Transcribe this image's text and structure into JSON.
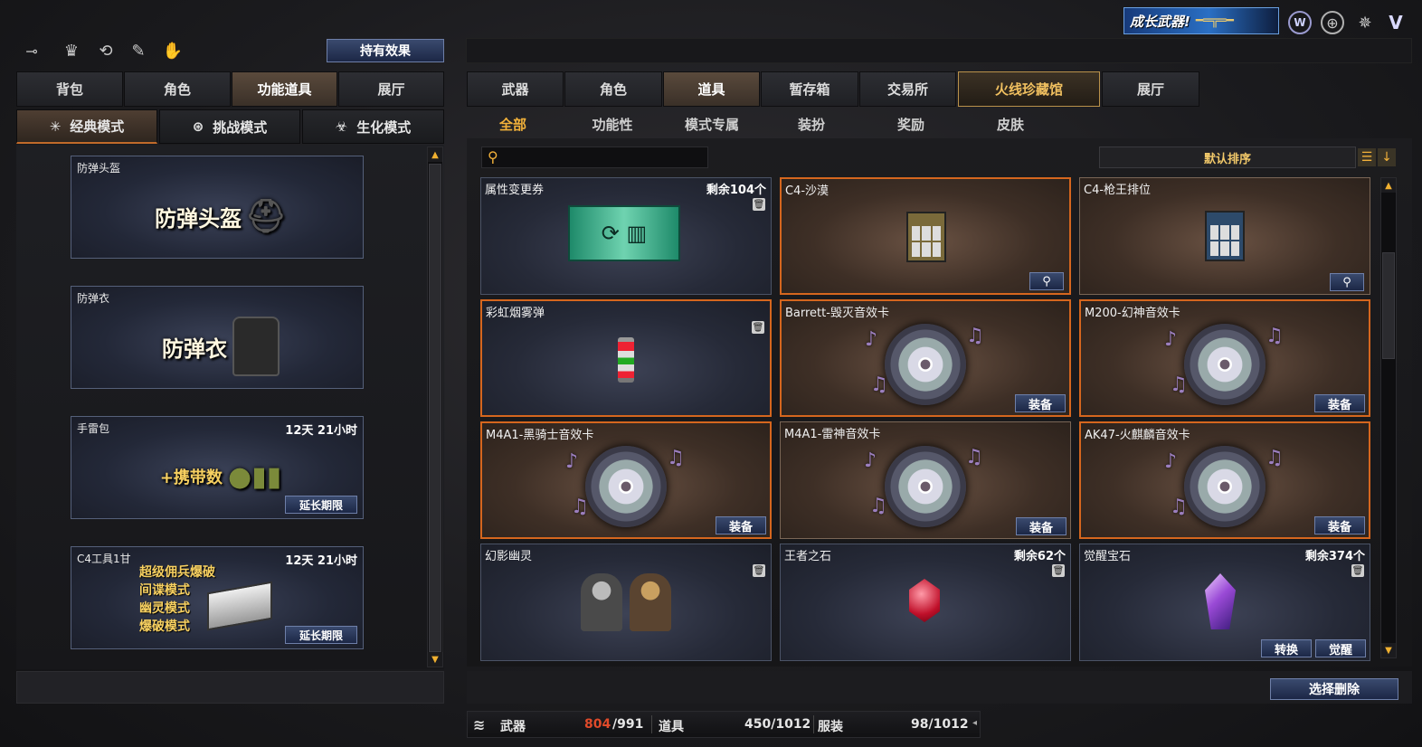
{
  "promo": {
    "text": "成长武器!"
  },
  "left": {
    "effects_button": "持有效果",
    "top_icons": [
      "key-icon",
      "gift-icon",
      "refresh-icon",
      "user-edit-icon",
      "hand-icon"
    ],
    "tabs": [
      {
        "label": "背包",
        "active": false
      },
      {
        "label": "角色",
        "active": false
      },
      {
        "label": "功能道具",
        "active": true
      },
      {
        "label": "展厅",
        "active": false
      }
    ],
    "modes": [
      {
        "label": "经典模式",
        "icon": "sparkle-icon",
        "active": true
      },
      {
        "label": "挑战模式",
        "icon": "target-icon",
        "active": false
      },
      {
        "label": "生化模式",
        "icon": "biohazard-icon",
        "active": false
      }
    ],
    "cards": [
      {
        "name": "防弹头盔",
        "art": "防弹头盔",
        "time": "",
        "extend": ""
      },
      {
        "name": "防弹衣",
        "art": "防弹衣",
        "time": "",
        "extend": ""
      },
      {
        "name": "手雷包",
        "art": "+携带数",
        "time": "12天 21小时",
        "extend": "延长期限"
      },
      {
        "name": "C4工具1甘",
        "art_lines": [
          "超级佣兵爆破",
          "间谍模式",
          "幽灵模式",
          "爆破模式"
        ],
        "time": "12天 21小时",
        "extend": "延长期限"
      }
    ]
  },
  "right": {
    "tabs": [
      {
        "label": "武器",
        "active": false,
        "special": false
      },
      {
        "label": "角色",
        "active": false,
        "special": false
      },
      {
        "label": "道具",
        "active": true,
        "special": false
      },
      {
        "label": "暂存箱",
        "active": false,
        "special": false
      },
      {
        "label": "交易所",
        "active": false,
        "special": false
      },
      {
        "label": "火线珍藏馆",
        "active": false,
        "special": true
      },
      {
        "label": "展厅",
        "active": false,
        "special": false
      }
    ],
    "subtabs": [
      {
        "label": "全部",
        "active": true
      },
      {
        "label": "功能性",
        "active": false
      },
      {
        "label": "模式专属",
        "active": false
      },
      {
        "label": "装扮",
        "active": false
      },
      {
        "label": "奖励",
        "active": false
      },
      {
        "label": "皮肤",
        "active": false
      }
    ],
    "search": {
      "placeholder": "",
      "value": ""
    },
    "sort_label": "默认排序",
    "items": [
      {
        "name": "属性变更券",
        "count": "剩余104个",
        "style": "blue",
        "kind": "ticket",
        "buttons": [],
        "trash": true,
        "mag": false
      },
      {
        "name": "C4-沙漠",
        "count": "",
        "style": "orange",
        "kind": "c4",
        "buttons": [],
        "trash": false,
        "mag": true
      },
      {
        "name": "C4-枪王排位",
        "count": "",
        "style": "brown",
        "kind": "c4b",
        "buttons": [],
        "trash": false,
        "mag": true
      },
      {
        "name": "彩虹烟雾弹",
        "count": "",
        "style": "orange-blue",
        "kind": "grenade",
        "buttons": [],
        "trash": true,
        "mag": false
      },
      {
        "name": "Barrett-毁灭音效卡",
        "count": "",
        "style": "orange",
        "kind": "disc",
        "buttons": [
          "装备"
        ],
        "trash": false,
        "mag": false
      },
      {
        "name": "M200-幻神音效卡",
        "count": "",
        "style": "orange",
        "kind": "disc",
        "buttons": [
          "装备"
        ],
        "trash": false,
        "mag": false
      },
      {
        "name": "M4A1-黑骑士音效卡",
        "count": "",
        "style": "orange",
        "kind": "disc",
        "buttons": [
          "装备"
        ],
        "trash": false,
        "mag": false
      },
      {
        "name": "M4A1-雷神音效卡",
        "count": "",
        "style": "brown",
        "kind": "disc",
        "buttons": [
          "装备"
        ],
        "trash": false,
        "mag": false
      },
      {
        "name": "AK47-火麒麟音效卡",
        "count": "",
        "style": "orange",
        "kind": "disc",
        "buttons": [
          "装备"
        ],
        "trash": false,
        "mag": false
      },
      {
        "name": "幻影幽灵",
        "count": "",
        "style": "blue",
        "kind": "soldiers",
        "buttons": [],
        "trash": true,
        "mag": false
      },
      {
        "name": "王者之石",
        "count": "剩余62个",
        "style": "blue",
        "kind": "redgem",
        "buttons": [],
        "trash": true,
        "mag": false
      },
      {
        "name": "觉醒宝石",
        "count": "剩余374个",
        "style": "blue",
        "kind": "purplegem",
        "buttons": [
          "转换",
          "觉醒"
        ],
        "trash": true,
        "mag": false
      }
    ],
    "delete_button": "选择删除"
  },
  "status": {
    "weapon_label": "武器",
    "weapon_used": "804",
    "weapon_total": "/991",
    "item_label": "道具",
    "item_count": "450/1012",
    "outfit_label": "服装",
    "outfit_count": "98/1012"
  },
  "colors": {
    "accent": "#f2b13a",
    "orange_border": "#d5661e",
    "used_red": "#e04a2a"
  }
}
